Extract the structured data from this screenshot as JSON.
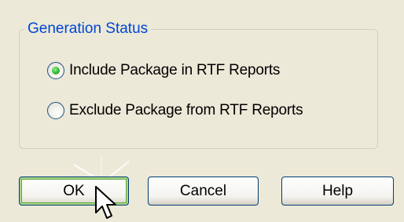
{
  "group": {
    "title": "Generation Status"
  },
  "options": [
    {
      "label": "Include Package in RTF Reports",
      "selected": true
    },
    {
      "label": "Exclude Package from RTF Reports",
      "selected": false
    }
  ],
  "buttons": {
    "ok": "OK",
    "cancel": "Cancel",
    "help": "Help"
  },
  "cursor": {
    "icon": "arrow-pointer-icon"
  },
  "colors": {
    "group_title": "#0046d5",
    "default_button_highlight": "#5ea93b",
    "radio_dot": "#3cc43c",
    "dialog_background": "#ece9d8"
  }
}
